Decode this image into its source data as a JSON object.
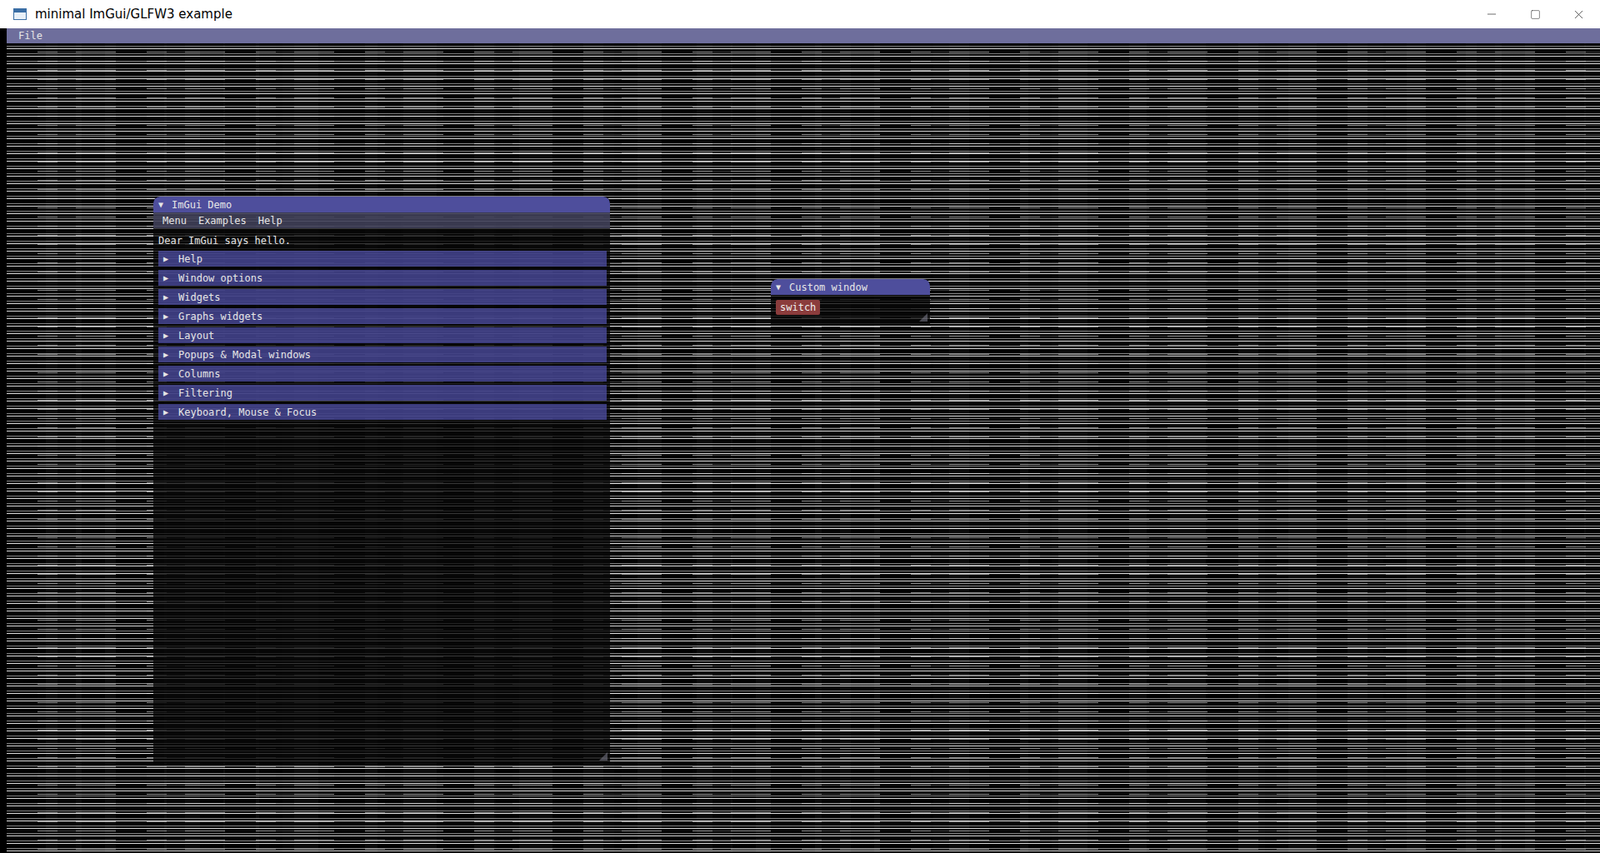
{
  "window": {
    "title": "minimal ImGui/GLFW3 example"
  },
  "menu_bar": [
    "File"
  ],
  "demo_window": {
    "title": "ImGui Demo",
    "collapse_icon": "▼",
    "expanded": true,
    "menu": [
      "Menu",
      "Examples",
      "Help"
    ],
    "text": "Dear ImGui says hello.",
    "headers": [
      {
        "label": "Help",
        "icon": "▶",
        "expanded": false
      },
      {
        "label": "Window options",
        "icon": "▶",
        "expanded": false
      },
      {
        "label": "Widgets",
        "icon": "▶",
        "expanded": false
      },
      {
        "label": "Graphs widgets",
        "icon": "▶",
        "expanded": false
      },
      {
        "label": "Layout",
        "icon": "▶",
        "expanded": false
      },
      {
        "label": "Popups & Modal windows",
        "icon": "▶",
        "expanded": false
      },
      {
        "label": "Columns",
        "icon": "▶",
        "expanded": false
      },
      {
        "label": "Filtering",
        "icon": "▶",
        "expanded": false
      },
      {
        "label": "Keyboard, Mouse & Focus",
        "icon": "▶",
        "expanded": false
      }
    ]
  },
  "custom_window": {
    "title": "Custom window",
    "collapse_icon": "▼",
    "expanded": true,
    "buttons": [
      "switch"
    ]
  }
}
